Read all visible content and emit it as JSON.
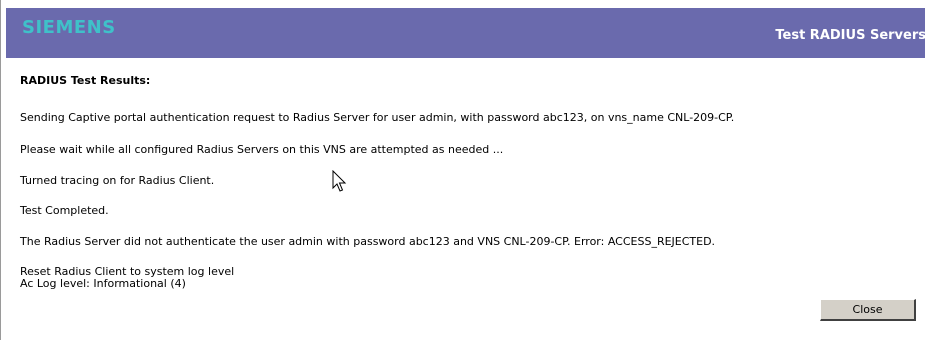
{
  "header": {
    "brand": "SIEMENS",
    "title": "Test RADIUS Servers"
  },
  "results": {
    "heading": "RADIUS Test Results:",
    "lines": [
      "Sending Captive portal authentication request to Radius Server for user admin, with password abc123, on vns_name CNL-209-CP.",
      "Please wait while all configured Radius Servers on this VNS are attempted as needed ...",
      "Turned tracing on for Radius Client.",
      "Test Completed.",
      "The Radius Server did not authenticate the user admin with password abc123 and VNS CNL-209-CP. Error: ACCESS_REJECTED.",
      "Reset Radius Client to system log level",
      "Ac Log level: Informational (4)"
    ]
  },
  "buttons": {
    "close_label": "Close"
  },
  "colors": {
    "header_bg": "#6a6aad",
    "brand": "#3fc1c9"
  },
  "icons": {
    "pointer": "mouse-pointer-icon"
  }
}
